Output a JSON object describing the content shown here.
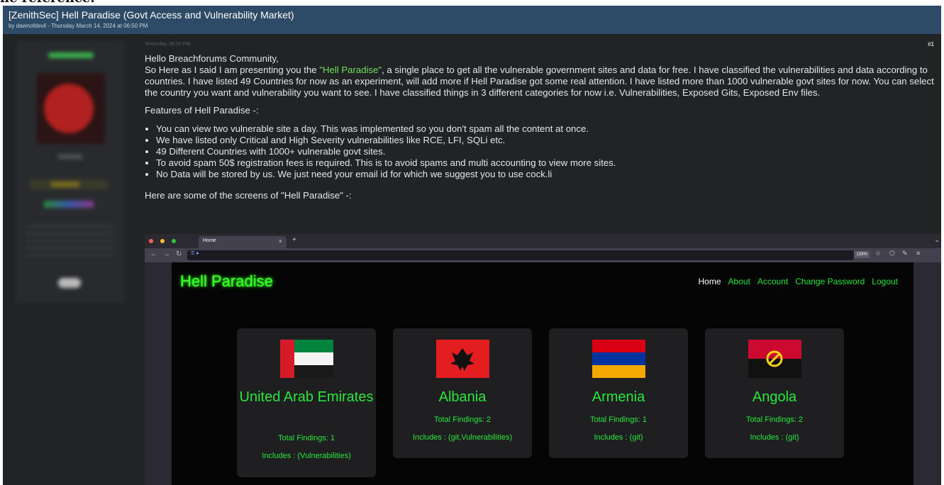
{
  "caption_fragment": "ne reference.",
  "thread": {
    "title": "[ZenithSec] Hell Paradise (Govt Access and Vulnerability Market)",
    "byline": "by dawnofdevil - Thursday March 14, 2024 at 06:50 PM"
  },
  "post": {
    "date": "Yesterday, 06:50 PM",
    "number": "#1",
    "greeting": "Hello Breachforums Community,",
    "intro_before": "So Here as I said I am presenting you the ",
    "intro_highlight": "\"Hell Paradise\"",
    "intro_after": ", a single place to get all the vulnerable government sites and data for free. I have classified the vulnerabilities and data according to countries. I have listed 49 Countries for now as an experiment, will add more if Hell Paradise got some real attention. I have listed more than 1000 vulnerable govt sites for now. You can select the country you want and vulnerability you want to see. I have classified things in 3 different categories for now i.e. Vulnerabilities, Exposed Gits, Exposed Env files.",
    "features_heading": "Features of Hell Paradise -:",
    "features": [
      "You can view two vulnerable site a day. This was implemented so you don't spam all the content at once.",
      "We have listed only Critical and High Severity vulnerabilities like RCE, LFI, SQLi etc.",
      "49 Different Countries with 1000+ vulnerable govt sites.",
      "To avoid spam 50$ registration fees is required. This is to avoid spams and multi accounting to view more sites.",
      "No Data will be stored by us. We just need your email id for which we suggest you to use cock.li"
    ],
    "screens_line": "Here are some of the screens of \"Hell Paradise\" -:"
  },
  "browser": {
    "tab_label": "Home",
    "tab_close": "×",
    "new_tab": "+",
    "zoom": "133%",
    "site": {
      "logo": "Hell Paradise",
      "nav": [
        "Home",
        "About",
        "Account",
        "Change Password",
        "Logout"
      ],
      "cards": [
        {
          "name": "United Arab Emirates",
          "findings": "Total Findings: 1",
          "includes": "Includes : (Vulnerabilities)"
        },
        {
          "name": "Albania",
          "findings": "Total Findings: 2",
          "includes": "Includes : (git,Vulnerabilities)"
        },
        {
          "name": "Armenia",
          "findings": "Total Findings: 1",
          "includes": "Includes : (git)"
        },
        {
          "name": "Angola",
          "findings": "Total Findings: 2",
          "includes": "Includes : (git)"
        }
      ]
    }
  },
  "colors": {
    "header_bg": "#2d4a66",
    "page_bg": "#222325",
    "highlight": "#6ee05a",
    "site_green": "#29e83c"
  },
  "icons": [
    "back-arrow-icon",
    "forward-arrow-icon",
    "reload-icon",
    "star-icon",
    "shield-icon",
    "extensions-icon",
    "menu-icon",
    "chevron-down-icon"
  ]
}
